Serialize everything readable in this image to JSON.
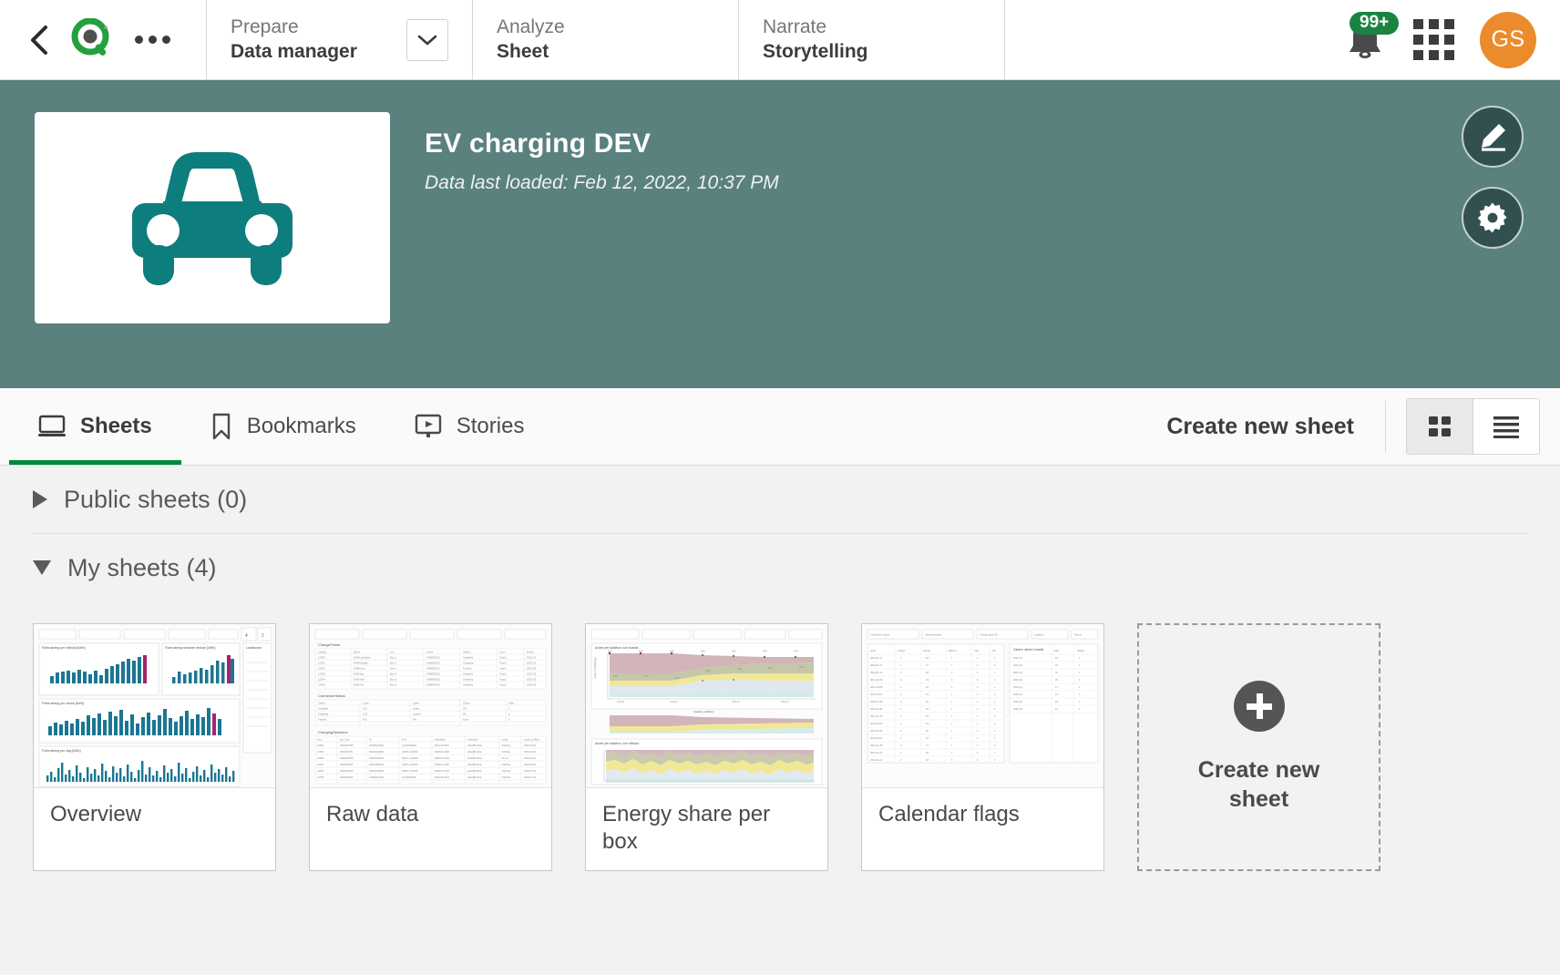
{
  "topnav": {
    "back_icon": "chevron-left-icon",
    "logo_icon": "qlik-logo-icon",
    "overflow_icon": "ellipsis-icon",
    "sections": [
      {
        "top": "Prepare",
        "bottom": "Data manager",
        "has_caret": true,
        "caret_icon": "chevron-down-icon"
      },
      {
        "top": "Analyze",
        "bottom": "Sheet",
        "has_caret": false
      },
      {
        "top": "Narrate",
        "bottom": "Storytelling",
        "has_caret": false
      }
    ],
    "notifications": {
      "icon": "bell-icon",
      "badge": "99+",
      "badge_color": "#1a8341"
    },
    "apps_icon": "grid-apps-icon",
    "avatar": {
      "initials": "GS",
      "color": "#eb8b2c"
    }
  },
  "app_header": {
    "background_color": "#5a817e",
    "thumbnail_icon": "car-icon",
    "thumbnail_icon_color": "#0d7d7d",
    "title": "EV charging DEV",
    "subtitle": "Data last loaded: Feb 12, 2022, 10:37 PM",
    "actions": [
      {
        "name": "edit-app-button",
        "icon": "pencil-icon"
      },
      {
        "name": "app-settings-button",
        "icon": "gear-icon"
      }
    ]
  },
  "tabs": {
    "items": [
      {
        "label": "Sheets",
        "icon": "sheet-icon",
        "active": true
      },
      {
        "label": "Bookmarks",
        "icon": "bookmark-icon",
        "active": false
      },
      {
        "label": "Stories",
        "icon": "story-icon",
        "active": false
      }
    ],
    "create_label": "Create new sheet",
    "view_modes": [
      {
        "name": "grid-view-toggle",
        "icon": "grid-view-icon",
        "active": true
      },
      {
        "name": "list-view-toggle",
        "icon": "list-view-icon",
        "active": false
      }
    ],
    "active_underline_color": "#00873d"
  },
  "sections": [
    {
      "title": "Public sheets (0)",
      "expanded": false,
      "count": 0
    },
    {
      "title": "My sheets (4)",
      "expanded": true,
      "count": 4
    }
  ],
  "sheets": [
    {
      "title": "Overview",
      "thumb": "bar-charts"
    },
    {
      "title": "Raw data",
      "thumb": "tables"
    },
    {
      "title": "Energy share per box",
      "thumb": "area-charts"
    },
    {
      "title": "Calendar flags",
      "thumb": "table-list"
    }
  ],
  "create_tile": {
    "label": "Create new sheet",
    "icon": "plus-circle-icon"
  }
}
